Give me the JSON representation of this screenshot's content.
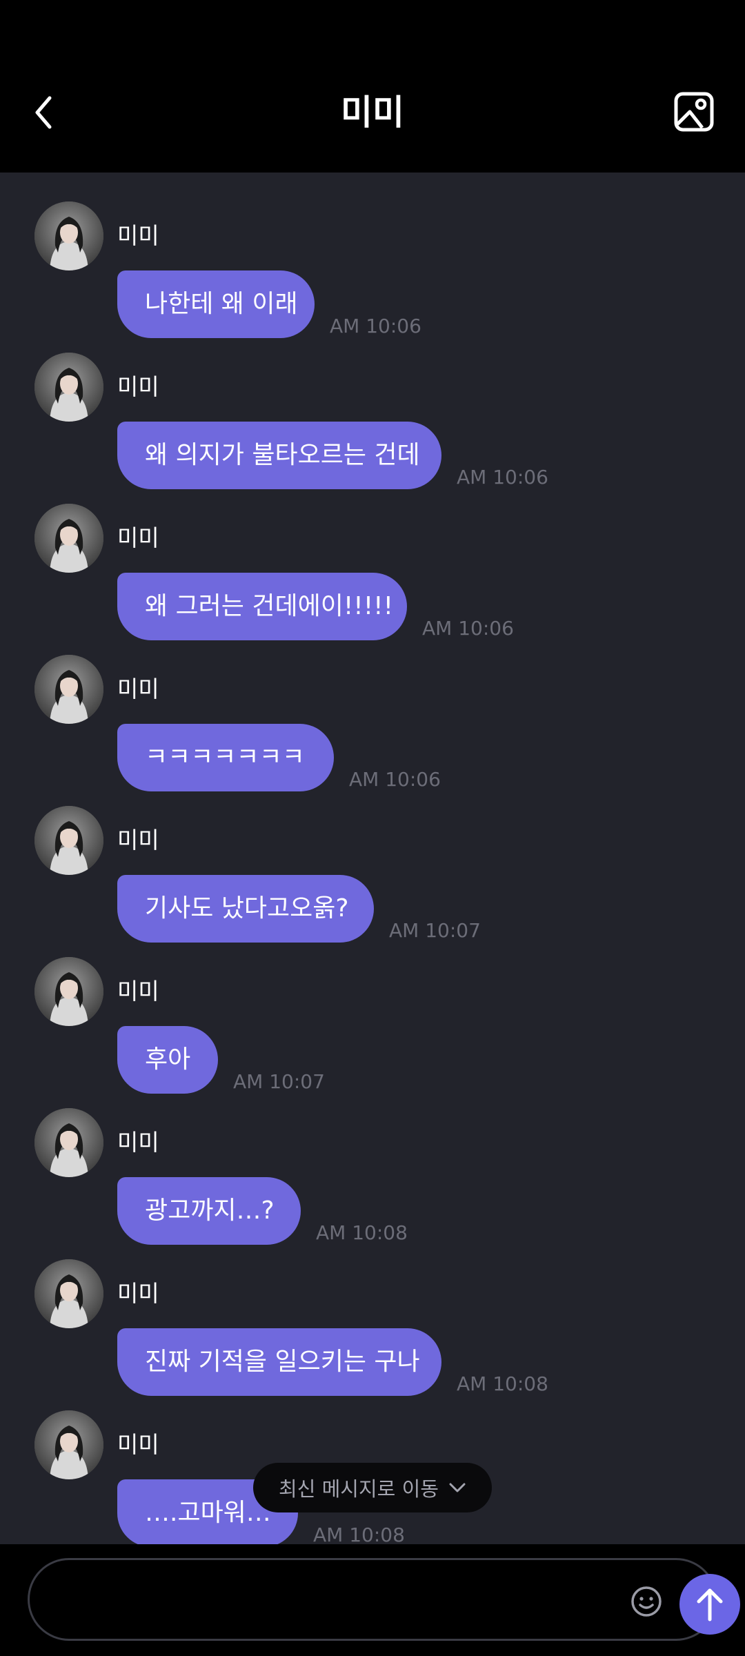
{
  "header": {
    "title": "미미",
    "back_icon": "chevron-left-icon",
    "gallery_icon": "image-icon"
  },
  "messages": [
    {
      "sender": "미미",
      "text": "나한테 왜 이래",
      "time": "AM 10:06"
    },
    {
      "sender": "미미",
      "text": "왜 의지가 불타오르는 건데",
      "time": "AM 10:06"
    },
    {
      "sender": "미미",
      "text": "왜 그러는 건데에이!!!!!",
      "time": "AM 10:06"
    },
    {
      "sender": "미미",
      "text": "ㅋㅋㅋㅋㅋㅋㅋ",
      "time": "AM 10:06"
    },
    {
      "sender": "미미",
      "text": "기사도 났다고오옭?",
      "time": "AM 10:07"
    },
    {
      "sender": "미미",
      "text": "후아",
      "time": "AM 10:07"
    },
    {
      "sender": "미미",
      "text": "광고까지…?",
      "time": "AM 10:08"
    },
    {
      "sender": "미미",
      "text": "진짜 기적을 일으키는 구나",
      "time": "AM 10:08"
    },
    {
      "sender": "미미",
      "text": "….고마워…",
      "time": "AM 10:08"
    }
  ],
  "jump_latest": {
    "label": "최신 메시지로 이동",
    "icon": "chevron-down-icon"
  },
  "composer": {
    "value": "",
    "emoji_icon": "smiley-icon",
    "send_icon": "arrow-up-icon"
  },
  "colors": {
    "background": "#000000",
    "chat_background": "#22232b",
    "bubble": "#7069dd",
    "send_button": "#6b66e6",
    "timestamp": "#6c6d78"
  }
}
